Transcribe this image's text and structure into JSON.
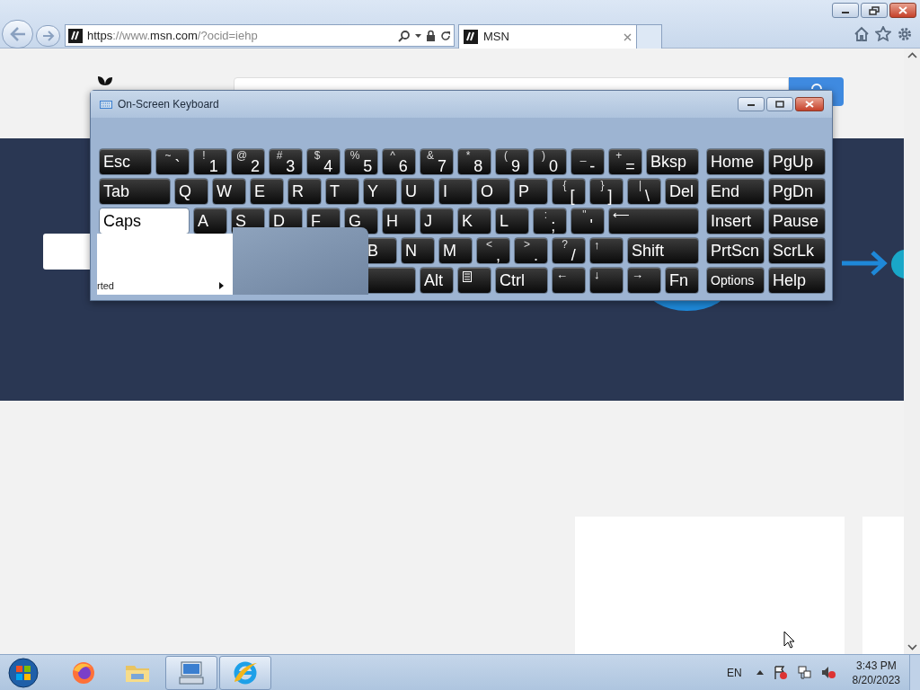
{
  "browser": {
    "url_parts": [
      {
        "text": "https",
        "dim": false
      },
      {
        "text": "://www.",
        "dim": true
      },
      {
        "text": "msn.com",
        "dim": false
      },
      {
        "text": "/?ocid=iehp",
        "dim": true
      }
    ],
    "tabs": [
      {
        "label": "MSN",
        "selected": true
      }
    ]
  },
  "keyboard": {
    "title": "On-Screen Keyboard",
    "rows": [
      {
        "keys": [
          {
            "kind": "label",
            "main": "Esc",
            "pressed": false
          },
          {
            "kind": "pair",
            "shift": "~",
            "main": "`",
            "pressed": false
          },
          {
            "kind": "pair",
            "shift": "!",
            "main": "1",
            "pressed": false
          },
          {
            "kind": "pair",
            "shift": "@",
            "main": "2",
            "pressed": false
          },
          {
            "kind": "pair",
            "shift": "#",
            "main": "3",
            "pressed": false
          },
          {
            "kind": "pair",
            "shift": "$",
            "main": "4",
            "pressed": false
          },
          {
            "kind": "pair",
            "shift": "%",
            "main": "5",
            "pressed": false
          },
          {
            "kind": "pair",
            "shift": "^",
            "main": "6",
            "pressed": false
          },
          {
            "kind": "pair",
            "shift": "&",
            "main": "7",
            "pressed": false
          },
          {
            "kind": "pair",
            "shift": "*",
            "main": "8",
            "pressed": false
          },
          {
            "kind": "pair",
            "shift": "(",
            "main": "9",
            "pressed": false
          },
          {
            "kind": "pair",
            "shift": ")",
            "main": "0",
            "pressed": false
          },
          {
            "kind": "pair",
            "shift": "_",
            "main": "-",
            "pressed": false
          },
          {
            "kind": "pair",
            "shift": "+",
            "main": "=",
            "pressed": false
          },
          {
            "kind": "label",
            "main": "Bksp",
            "pressed": false
          }
        ]
      },
      {
        "keys": [
          {
            "kind": "label",
            "main": "Tab",
            "pressed": false
          },
          {
            "kind": "label",
            "main": "Q",
            "pressed": false
          },
          {
            "kind": "label",
            "main": "W",
            "pressed": false
          },
          {
            "kind": "label",
            "main": "E",
            "pressed": false
          },
          {
            "kind": "label",
            "main": "R",
            "pressed": false
          },
          {
            "kind": "label",
            "main": "T",
            "pressed": false
          },
          {
            "kind": "label",
            "main": "Y",
            "pressed": false
          },
          {
            "kind": "label",
            "main": "U",
            "pressed": false
          },
          {
            "kind": "label",
            "main": "I",
            "pressed": false
          },
          {
            "kind": "label",
            "main": "O",
            "pressed": false
          },
          {
            "kind": "label",
            "main": "P",
            "pressed": false
          },
          {
            "kind": "pair",
            "shift": "{",
            "main": "[",
            "pressed": false
          },
          {
            "kind": "pair",
            "shift": "}",
            "main": "]",
            "pressed": false
          },
          {
            "kind": "pair",
            "shift": "|",
            "main": "\\",
            "pressed": false
          },
          {
            "kind": "label",
            "main": "Del",
            "pressed": false
          }
        ]
      },
      {
        "keys": [
          {
            "kind": "label",
            "main": "Caps",
            "pressed": true
          },
          {
            "kind": "label",
            "main": "A",
            "pressed": false
          },
          {
            "kind": "label",
            "main": "S",
            "pressed": false
          },
          {
            "kind": "label",
            "main": "D",
            "pressed": false
          },
          {
            "kind": "label",
            "main": "F",
            "pressed": false
          },
          {
            "kind": "label",
            "main": "G",
            "pressed": false
          },
          {
            "kind": "label",
            "main": "H",
            "pressed": false
          },
          {
            "kind": "label",
            "main": "J",
            "pressed": false
          },
          {
            "kind": "label",
            "main": "K",
            "pressed": false
          },
          {
            "kind": "label",
            "main": "L",
            "pressed": false
          },
          {
            "kind": "pair",
            "shift": ":",
            "main": ";",
            "pressed": false
          },
          {
            "kind": "pair",
            "shift": "\"",
            "main": "'",
            "pressed": false
          },
          {
            "kind": "arrow",
            "main": "⟵",
            "pressed": false
          }
        ]
      },
      {
        "keys": [
          {
            "kind": "label",
            "main": "B",
            "pressed": false
          },
          {
            "kind": "label",
            "main": "N",
            "pressed": false
          },
          {
            "kind": "label",
            "main": "M",
            "pressed": false
          },
          {
            "kind": "pair",
            "shift": "<",
            "main": ",",
            "pressed": false
          },
          {
            "kind": "pair",
            "shift": ">",
            "main": ".",
            "pressed": false
          },
          {
            "kind": "pair",
            "shift": "?",
            "main": "/",
            "pressed": false
          },
          {
            "kind": "arrow",
            "main": "↑",
            "pressed": false
          },
          {
            "kind": "label",
            "main": "Shift",
            "pressed": false
          }
        ]
      },
      {
        "keys": [
          {
            "kind": "space",
            "pressed": false
          },
          {
            "kind": "label",
            "main": "Alt",
            "pressed": false
          },
          {
            "kind": "menu",
            "pressed": false
          },
          {
            "kind": "label",
            "main": "Ctrl",
            "pressed": false
          },
          {
            "kind": "arrow",
            "main": "←",
            "pressed": false
          },
          {
            "kind": "arrow",
            "main": "↓",
            "pressed": false
          },
          {
            "kind": "arrow",
            "main": "→",
            "pressed": false
          },
          {
            "kind": "label",
            "main": "Fn",
            "pressed": false
          }
        ]
      }
    ],
    "side_rows": [
      {
        "keys": [
          {
            "kind": "label",
            "main": "Home",
            "pressed": false
          },
          {
            "kind": "label",
            "main": "PgUp",
            "pressed": false
          }
        ]
      },
      {
        "keys": [
          {
            "kind": "label",
            "main": "End",
            "pressed": false
          },
          {
            "kind": "label",
            "main": "PgDn",
            "pressed": false
          }
        ]
      },
      {
        "keys": [
          {
            "kind": "label",
            "main": "Insert",
            "pressed": false
          },
          {
            "kind": "label",
            "main": "Pause",
            "pressed": false
          }
        ]
      },
      {
        "keys": [
          {
            "kind": "label",
            "main": "PrtScn",
            "pressed": false
          },
          {
            "kind": "label",
            "main": "ScrLk",
            "pressed": false
          }
        ]
      },
      {
        "keys": [
          {
            "kind": "small",
            "main": "Options",
            "pressed": false
          },
          {
            "kind": "label",
            "main": "Help",
            "pressed": false
          }
        ]
      }
    ]
  },
  "start_menu": {
    "items": [
      {
        "label": "rted",
        "has_submenu": true
      }
    ]
  },
  "taskbar": {
    "apps": [
      {
        "kind": "firefox",
        "active": false
      },
      {
        "kind": "folder",
        "active": false
      },
      {
        "kind": "keyboard",
        "active": true
      },
      {
        "kind": "ie",
        "active": true
      }
    ],
    "language": "EN",
    "time": "3:43 PM",
    "date": "8/20/2023"
  }
}
